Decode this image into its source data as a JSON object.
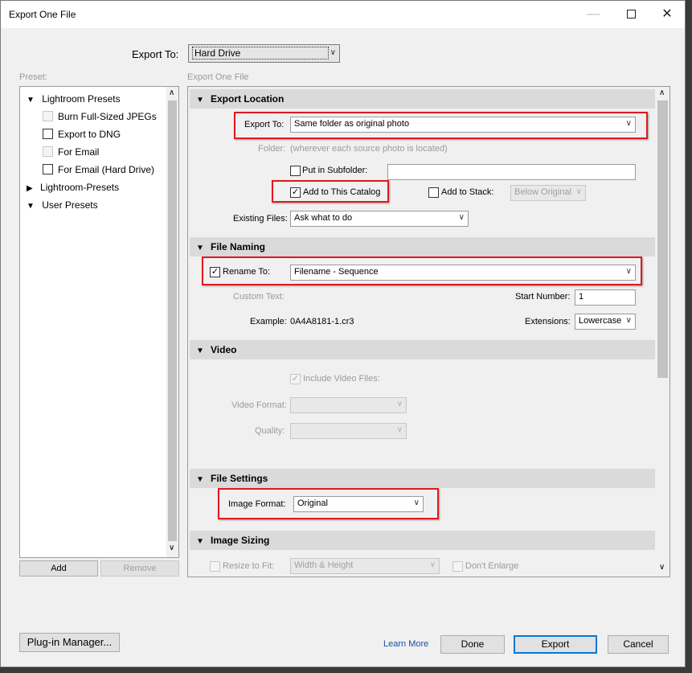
{
  "window": {
    "title": "Export One File",
    "min_icon": "minimize-icon",
    "max_icon": "maximize-icon",
    "close_icon": "close-icon"
  },
  "export_to": {
    "label": "Export To:",
    "value": "Hard Drive"
  },
  "preset": {
    "label": "Preset:",
    "groups": [
      {
        "label": "Lightroom Presets",
        "expanded": true,
        "items": [
          {
            "label": "Burn Full-Sized JPEGs",
            "checked": false,
            "enabled": false
          },
          {
            "label": "Export to DNG",
            "checked": false,
            "enabled": true
          },
          {
            "label": "For Email",
            "checked": false,
            "enabled": false
          },
          {
            "label": "For Email (Hard Drive)",
            "checked": false,
            "enabled": true
          }
        ]
      },
      {
        "label": "Lightroom-Presets",
        "expanded": false
      },
      {
        "label": "User Presets",
        "expanded": true
      }
    ],
    "add_label": "Add",
    "remove_label": "Remove"
  },
  "settings_title": "Export One File",
  "export_location": {
    "header": "Export Location",
    "export_to_label": "Export To:",
    "export_to_value": "Same folder as original photo",
    "folder_label": "Folder:",
    "folder_value": "(wherever each source photo is located)",
    "subfolder_label": "Put in Subfolder:",
    "subfolder_checked": false,
    "subfolder_value": "",
    "add_catalog_label": "Add to This Catalog",
    "add_catalog_checked": true,
    "add_stack_label": "Add to Stack:",
    "add_stack_checked": false,
    "stack_value": "Below Original",
    "existing_label": "Existing Files:",
    "existing_value": "Ask what to do"
  },
  "file_naming": {
    "header": "File Naming",
    "rename_label": "Rename To:",
    "rename_checked": true,
    "rename_value": "Filename - Sequence",
    "custom_text_label": "Custom Text:",
    "start_number_label": "Start Number:",
    "start_number_value": "1",
    "example_label": "Example:",
    "example_value": "0A4A8181-1.cr3",
    "extensions_label": "Extensions:",
    "extensions_value": "Lowercase"
  },
  "video": {
    "header": "Video",
    "include_label": "Include Video Files:",
    "include_checked": true,
    "format_label": "Video Format:",
    "quality_label": "Quality:"
  },
  "file_settings": {
    "header": "File Settings",
    "format_label": "Image Format:",
    "format_value": "Original"
  },
  "image_sizing": {
    "header": "Image Sizing",
    "resize_label": "Resize to Fit:",
    "resize_checked": false,
    "resize_value": "Width & Height",
    "dont_enlarge_label": "Don't Enlarge",
    "dont_enlarge_checked": false
  },
  "footer": {
    "plugin_label": "Plug-in Manager...",
    "learn_more": "Learn More",
    "done_label": "Done",
    "export_label": "Export",
    "cancel_label": "Cancel"
  },
  "colors": {
    "highlight": "#e0181f",
    "accent": "#0078d7",
    "link": "#1a4fa0",
    "section_bg": "#dadada"
  }
}
